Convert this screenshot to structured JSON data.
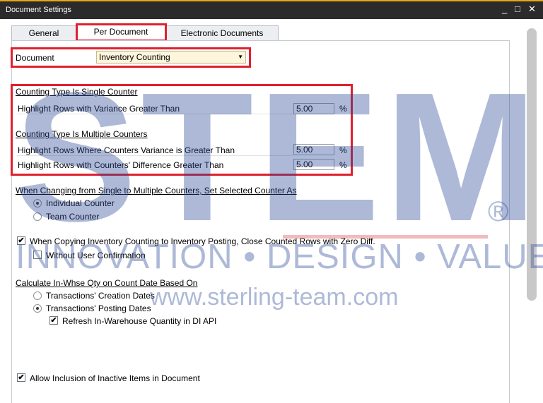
{
  "window": {
    "title": "Document Settings",
    "minimize": "_",
    "maximize": "□",
    "close": "✕"
  },
  "tabs": [
    {
      "label": "General"
    },
    {
      "label": "Per Document"
    },
    {
      "label": "Electronic Documents"
    }
  ],
  "document": {
    "label": "Document",
    "value": "Inventory Counting",
    "arrow": "▼"
  },
  "single": {
    "heading": "Counting Type Is Single Counter",
    "row_label": "Highlight Rows with Variance Greater Than",
    "value": "5.00",
    "unit": "%"
  },
  "multiple": {
    "heading": "Counting Type Is Multiple Counters",
    "rows": [
      {
        "label": "Highlight Rows Where Counters Variance is Greater Than",
        "value": "5.00",
        "unit": "%"
      },
      {
        "label": "Highlight Rows with Counters' Difference Greater Than",
        "value": "5.00",
        "unit": "%"
      }
    ]
  },
  "changing": {
    "heading": "When Changing from Single to Multiple Counters, Set Selected Counter As",
    "options": [
      "Individual Counter",
      "Team Counter"
    ],
    "selected": 0
  },
  "copying": {
    "label": "When Copying Inventory Counting to Inventory Posting, Close Counted Rows with Zero Diff.",
    "checked": true,
    "sub_label": "Without User Confirmation",
    "sub_checked": false
  },
  "calc": {
    "heading": "Calculate In-Whse Qty on Count Date Based On",
    "options": [
      "Transactions' Creation Dates",
      "Transactions' Posting Dates"
    ],
    "selected": 1,
    "refresh_label": "Refresh In-Warehouse Quantity in DI API",
    "refresh_checked": true
  },
  "inactive": {
    "label": "Allow Inclusion of Inactive Items in Document",
    "checked": true
  },
  "watermark": {
    "big": "STEM",
    "tagline": "INNOVATION • DESIGN • VALUE",
    "site": "www.sterling-team.com",
    "reg": "®"
  },
  "colors": {
    "highlight_border": "#e0202e",
    "dropdown_bg": "#fdf5dc",
    "titlebar": "#2b2b2b",
    "title_accent": "#e8a419"
  },
  "check_glyph": "✔"
}
